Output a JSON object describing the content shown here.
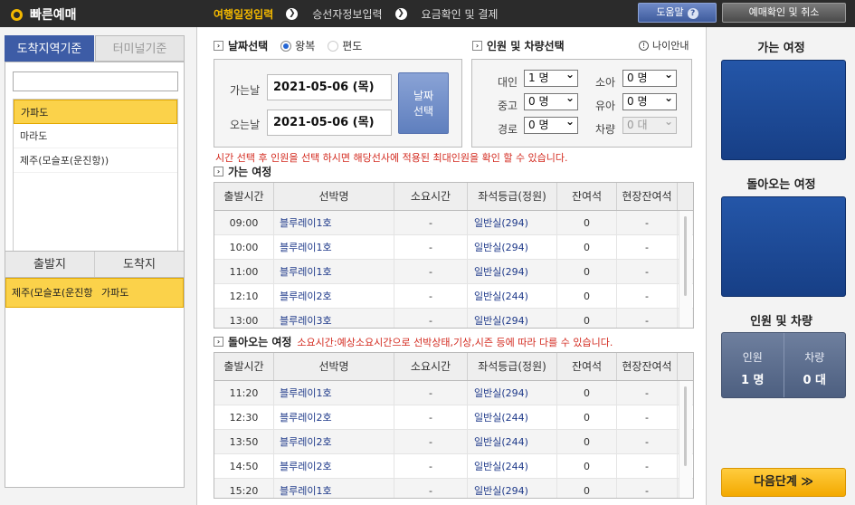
{
  "header": {
    "logo_text": "빠른예매",
    "steps": [
      "여행일정입력",
      "승선자정보입력",
      "요금확인 및 결제"
    ],
    "step_arrow": "❯",
    "help_label": "도움말",
    "help_icon": "?",
    "cancel_label": "예매확인 및 취소",
    "accent_color": "#f3b800"
  },
  "left": {
    "tabs": [
      "도착지역기준",
      "터미널기준"
    ],
    "search": {
      "value": ""
    },
    "destinations": [
      "가파도",
      "마라도",
      "제주(모슬포(운진항))"
    ],
    "route_headers": [
      "출발지",
      "도착지"
    ],
    "route": {
      "from": "제주(모슬포(운진항",
      "to": "가파도"
    }
  },
  "date": {
    "title": "날짜선택",
    "trip_types": [
      "왕복",
      "편도"
    ],
    "selected_trip": "왕복",
    "go_label": "가는날",
    "go_value": "2021-05-06 (목)",
    "return_label": "오는날",
    "return_value": "2021-05-06 (목)",
    "select_button": [
      "날짜",
      "선택"
    ]
  },
  "pax": {
    "title": "인원 및 차량선택",
    "age_note": "나이안내",
    "fields": [
      {
        "label": "대인",
        "value": "1 명"
      },
      {
        "label": "소아",
        "value": "0 명"
      },
      {
        "label": "중고",
        "value": "0 명"
      },
      {
        "label": "유아",
        "value": "0 명"
      },
      {
        "label": "경로",
        "value": "0 명"
      },
      {
        "label": "차량",
        "value": "0 대"
      }
    ]
  },
  "notice": "시간 선택 후 인원을 선택 하시면 해당선사에 적용된 최대인원을 확인 할 수 있습니다.",
  "outbound": {
    "title": "가는 여정",
    "headers": [
      "출발시간",
      "선박명",
      "소요시간",
      "좌석등급(정원)",
      "잔여석",
      "현장잔여석"
    ],
    "rows": [
      [
        "09:00",
        "블루레이1호",
        "-",
        "일반실(294)",
        "0",
        "-"
      ],
      [
        "10:00",
        "블루레이1호",
        "-",
        "일반실(294)",
        "0",
        "-"
      ],
      [
        "11:00",
        "블루레이1호",
        "-",
        "일반실(294)",
        "0",
        "-"
      ],
      [
        "12:10",
        "블루레이2호",
        "-",
        "일반실(244)",
        "0",
        "-"
      ],
      [
        "13:00",
        "블루레이3호",
        "-",
        "일반실(294)",
        "0",
        "-"
      ]
    ]
  },
  "inbound": {
    "title": "돌아오는 여정",
    "note": "소요시간:예상소요시간으로 선박상태,기상,시즌 등에 따라 다를 수 있습니다.",
    "headers": [
      "출발시간",
      "선박명",
      "소요시간",
      "좌석등급(정원)",
      "잔여석",
      "현장잔여석"
    ],
    "rows": [
      [
        "11:20",
        "블루레이1호",
        "-",
        "일반실(294)",
        "0",
        "-"
      ],
      [
        "12:30",
        "블루레이2호",
        "-",
        "일반실(244)",
        "0",
        "-"
      ],
      [
        "13:50",
        "블루레이2호",
        "-",
        "일반실(244)",
        "0",
        "-"
      ],
      [
        "14:50",
        "블루레이2호",
        "-",
        "일반실(244)",
        "0",
        "-"
      ],
      [
        "15:20",
        "블루레이1호",
        "-",
        "일반실(294)",
        "0",
        "-"
      ]
    ]
  },
  "summary": {
    "go_title": "가는 여정",
    "return_title": "돌아오는 여정",
    "pax_title": "인원 및 차량",
    "pax_label": "인원",
    "pax_value": "1 명",
    "car_label": "차량",
    "car_value": "0 대",
    "next_label": "다음단계 ≫"
  }
}
